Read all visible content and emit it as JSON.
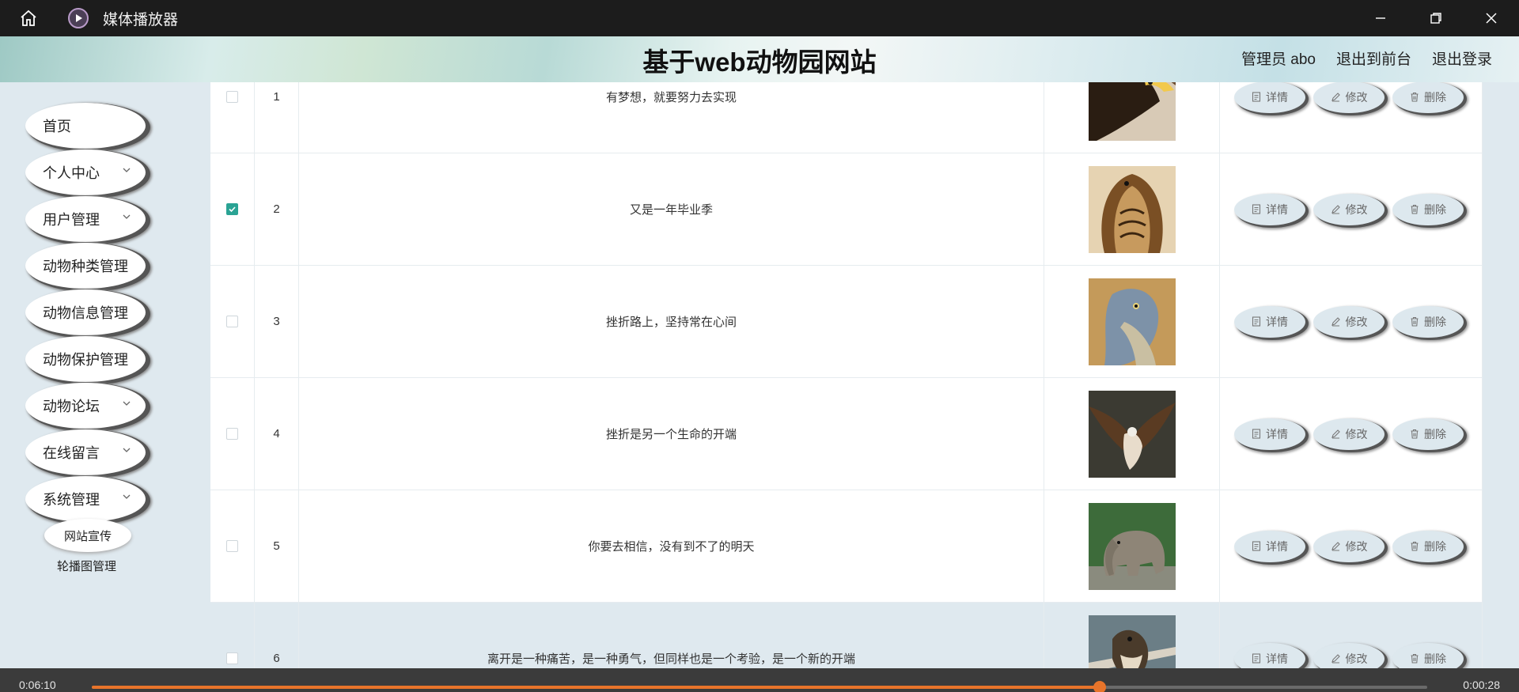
{
  "player": {
    "title": "媒体播放器",
    "elapsed": "0:06:10",
    "remaining": "0:00:28",
    "progress": 0.755
  },
  "site": {
    "title": "基于web动物园网站",
    "admin": "管理员 abo",
    "to_front": "退出到前台",
    "logout": "退出登录"
  },
  "sidebar": {
    "items": [
      {
        "label": "首页",
        "chevron": false
      },
      {
        "label": "个人中心",
        "chevron": true
      },
      {
        "label": "用户管理",
        "chevron": true
      },
      {
        "label": "动物种类管理",
        "chevron": false
      },
      {
        "label": "动物信息管理",
        "chevron": false
      },
      {
        "label": "动物保护管理",
        "chevron": false
      },
      {
        "label": "动物论坛",
        "chevron": true
      },
      {
        "label": "在线留言",
        "chevron": true
      },
      {
        "label": "系统管理",
        "chevron": true
      }
    ],
    "sub1": "网站宣传",
    "sub2": "轮播图管理"
  },
  "table": {
    "actions": {
      "detail": "详情",
      "edit": "修改",
      "delete": "删除"
    },
    "rows": [
      {
        "num": "1",
        "text": "有梦想，就要努力去实现",
        "checked": false,
        "animal": "eagle"
      },
      {
        "num": "2",
        "text": "又是一年毕业季",
        "checked": true,
        "animal": "cobra"
      },
      {
        "num": "3",
        "text": "挫折路上，坚持常在心间",
        "checked": false,
        "animal": "shoebill"
      },
      {
        "num": "4",
        "text": "挫折是另一个生命的开端",
        "checked": false,
        "animal": "hawk"
      },
      {
        "num": "5",
        "text": "你要去相信，没有到不了的明天",
        "checked": false,
        "animal": "elephant"
      },
      {
        "num": "6",
        "text": "离开是一种痛苦，是一种勇气，但同样也是一个考验，是一个新的开端",
        "checked": false,
        "animal": "bird"
      }
    ]
  },
  "colors": {
    "accent": "#e8742a",
    "check": "#2aa394",
    "sidebar_bg": "#dfe9ef"
  }
}
